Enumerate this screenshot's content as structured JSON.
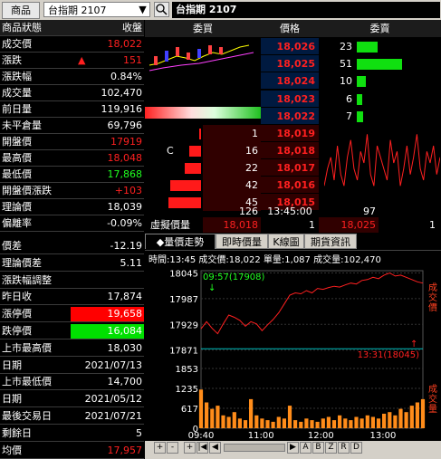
{
  "toolbar": {
    "product_button": "商品",
    "combo_value": "台指期 2107",
    "title": "台指期 2107"
  },
  "left_table": {
    "header": {
      "label": "商品狀態",
      "value": "收盤"
    },
    "rows": [
      {
        "label": "成交價",
        "value": "18,022",
        "color": "#ff2020"
      },
      {
        "label": "漲跌",
        "value": "151",
        "color": "#ff2020",
        "arrow": "▲"
      },
      {
        "label": "漲跌幅",
        "value": "0.84%",
        "color": "#ffffff"
      },
      {
        "label": "成交量",
        "value": "102,470",
        "color": "#ffffff"
      },
      {
        "label": "前日量",
        "value": "119,916",
        "color": "#ffffff"
      },
      {
        "label": "未平倉量",
        "value": "69,796",
        "color": "#ffffff"
      },
      {
        "label": "開盤價",
        "value": "17919",
        "color": "#ff2020"
      },
      {
        "label": "最高價",
        "value": "18,048",
        "color": "#ff2020"
      },
      {
        "label": "最低價",
        "value": "17,868",
        "color": "#20ff20"
      },
      {
        "label": "開盤價漲跌",
        "value": "+103",
        "color": "#ff2020"
      },
      {
        "label": "理論價",
        "value": "18,039",
        "color": "#ffffff"
      },
      {
        "label": "偏離率",
        "value": "-0.09%",
        "color": "#ffffff"
      }
    ],
    "rows2": [
      {
        "label": "價差",
        "value": "-12.19",
        "color": "#ffffff"
      },
      {
        "label": "理論價差",
        "value": "5.11",
        "color": "#ffffff"
      },
      {
        "label": "漲跌幅調整",
        "value": "",
        "color": "#ffffff"
      },
      {
        "label": "昨日收",
        "value": "17,874",
        "color": "#ffffff"
      },
      {
        "label": "漲停價",
        "value": "19,658",
        "color": "#ffffff",
        "bg": "#ff0000"
      },
      {
        "label": "跌停價",
        "value": "16,084",
        "color": "#ffffff",
        "bg": "#00e000"
      },
      {
        "label": "上市最高價",
        "value": "18,030",
        "color": "#ffffff"
      },
      {
        "label": "日期",
        "value": "2021/07/13",
        "color": "#ffffff"
      },
      {
        "label": "上市最低價",
        "value": "14,700",
        "color": "#ffffff"
      },
      {
        "label": "日期",
        "value": "2021/05/12",
        "color": "#ffffff"
      },
      {
        "label": "最後交易日",
        "value": "2021/07/21",
        "color": "#ffffff"
      },
      {
        "label": "剩餘日",
        "value": "5",
        "color": "#ffffff"
      },
      {
        "label": "均價",
        "value": "17,957",
        "color": "#ff2020"
      }
    ]
  },
  "order_book": {
    "headers": {
      "bid": "委買",
      "price": "價格",
      "ask": "委賣"
    },
    "asks": [
      {
        "price": "18,026",
        "qty": "23"
      },
      {
        "price": "18,025",
        "qty": "51"
      },
      {
        "price": "18,024",
        "qty": "10"
      },
      {
        "price": "18,023",
        "qty": "6"
      },
      {
        "price": "18,022",
        "qty": "7"
      }
    ],
    "bids": [
      {
        "price": "18,019",
        "qty": "1"
      },
      {
        "price": "18,018",
        "qty": "16",
        "mark": "C"
      },
      {
        "price": "18,017",
        "qty": "22"
      },
      {
        "price": "18,016",
        "qty": "42"
      },
      {
        "price": "18,015",
        "qty": "45"
      }
    ],
    "summary": {
      "left": "126",
      "time": "13:45:00",
      "right": "97"
    },
    "virtual": {
      "label": "虛擬價量",
      "price1": "18,018",
      "qty1": "1",
      "price2": "18,025",
      "qty2": "1"
    },
    "ask_bar_max": 51,
    "bid_bar_max": 45,
    "colors": {
      "ask_price_bg": "#001a40",
      "bid_price_bg": "#300000",
      "up": "#ff2020",
      "down": "#20ff20"
    }
  },
  "tabs": [
    {
      "label": "◆量價走勢",
      "active": true
    },
    {
      "label": "即時價量",
      "active": false
    },
    {
      "label": "K線圖",
      "active": false
    },
    {
      "label": "期貨資訊",
      "active": false
    }
  ],
  "chart_info": {
    "line": "時間:13:45 成交價:18,022 單量:1,087 成交量:102,470",
    "label_price_axis": "成交價",
    "label_volume_axis": "成交量",
    "annotation_low": "09:57(17908)",
    "annotation_high": "13:31(18045)"
  },
  "chart_data": {
    "type": "line",
    "x_ticks": [
      "09:40",
      "11:00",
      "12:00",
      "13:00"
    ],
    "y_ticks_price": [
      "18045",
      "17987",
      "17929",
      "17871"
    ],
    "y_ticks_volume": [
      "1853",
      "1235",
      "617",
      "0"
    ],
    "ylim_price": [
      17850,
      18050
    ],
    "ylim_volume": [
      0,
      1853
    ],
    "reference_price": 17874,
    "x": [
      0,
      1,
      2,
      3,
      4,
      5,
      6,
      7,
      8,
      9,
      10,
      11,
      12,
      13,
      14,
      15,
      16,
      17,
      18,
      19,
      20,
      21,
      22,
      23,
      24,
      25,
      26,
      27,
      28,
      29,
      30,
      31,
      32,
      33,
      34,
      35,
      36,
      37,
      38,
      39,
      40
    ],
    "price_series": [
      17919,
      17935,
      17920,
      17908,
      17930,
      17950,
      17945,
      17938,
      17925,
      17935,
      17930,
      17915,
      17928,
      17940,
      17955,
      17975,
      17995,
      18000,
      17998,
      18005,
      18000,
      18010,
      18008,
      18012,
      18015,
      18013,
      18018,
      18022,
      18020,
      18028,
      18030,
      18035,
      18032,
      18040,
      18045,
      18038,
      18040,
      18035,
      18030,
      18025,
      18022
    ],
    "volume_series": [
      1200,
      800,
      600,
      700,
      400,
      350,
      500,
      300,
      250,
      900,
      400,
      300,
      250,
      200,
      350,
      300,
      700,
      250,
      200,
      300,
      250,
      200,
      300,
      350,
      250,
      400,
      300,
      250,
      350,
      300,
      400,
      350,
      300,
      450,
      500,
      400,
      600,
      500,
      700,
      800,
      900
    ]
  },
  "chart_footer": {
    "buttons_left": [
      "+",
      "-",
      "+",
      "|◀",
      "◀"
    ],
    "buttons_right": [
      "▶",
      "A",
      "B",
      "Z",
      "R",
      "D"
    ]
  },
  "side_trend": [
    18015,
    18018,
    18020,
    18016,
    18022,
    18017,
    18015,
    18020,
    18023,
    18018,
    18016,
    18021,
    18019,
    18024,
    18017,
    18015,
    18022,
    18020,
    18018,
    18016,
    18023,
    18019,
    18021,
    18015,
    18018,
    18022,
    18017,
    18020,
    18024,
    18018,
    18016,
    18021,
    18019,
    18022,
    18017,
    18020
  ]
}
